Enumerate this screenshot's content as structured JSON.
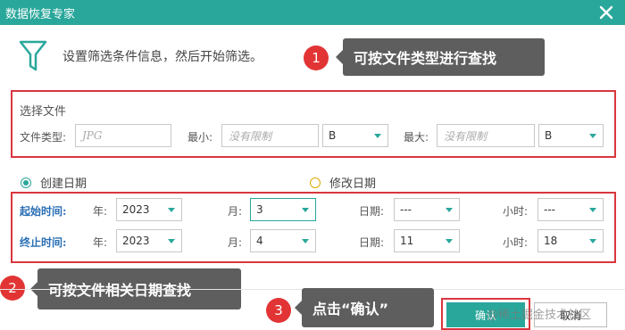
{
  "window": {
    "title": "数据恢复专家"
  },
  "header": {
    "description": "设置筛选条件信息，然后开始筛选。"
  },
  "file_section": {
    "title": "选择文件",
    "type_label": "文件类型:",
    "type_placeholder": "JPG",
    "min_label": "最小:",
    "min_placeholder": "没有限制",
    "min_unit": "B",
    "max_label": "最大:",
    "max_placeholder": "没有限制",
    "max_unit": "B"
  },
  "date_mode": {
    "created": "创建日期",
    "modified": "修改日期",
    "selected": "created"
  },
  "start": {
    "label": "起始时间:",
    "year_label": "年:",
    "year": "2023",
    "month_label": "月:",
    "month": "3",
    "day_label": "日期:",
    "day": "---",
    "hour_label": "小时:",
    "hour": "---"
  },
  "end": {
    "label": "终止时间:",
    "year_label": "年:",
    "year": "2023",
    "month_label": "月:",
    "month": "4",
    "day_label": "日期:",
    "day": "11",
    "hour_label": "小时:",
    "hour": "18"
  },
  "annotations": [
    {
      "number": "1",
      "text": "可按文件类型进行查找"
    },
    {
      "number": "2",
      "text": "可按文件相关日期查找"
    },
    {
      "number": "3",
      "text": "点击“确认”"
    }
  ],
  "buttons": {
    "confirm": "确认",
    "cancel": "取消"
  },
  "watermark": "@稀土掘金技术社区",
  "colors": {
    "accent": "#2aa79b",
    "highlight": "#d9363e",
    "callout": "#5e5e5e",
    "date_label": "#2a6fb5"
  }
}
